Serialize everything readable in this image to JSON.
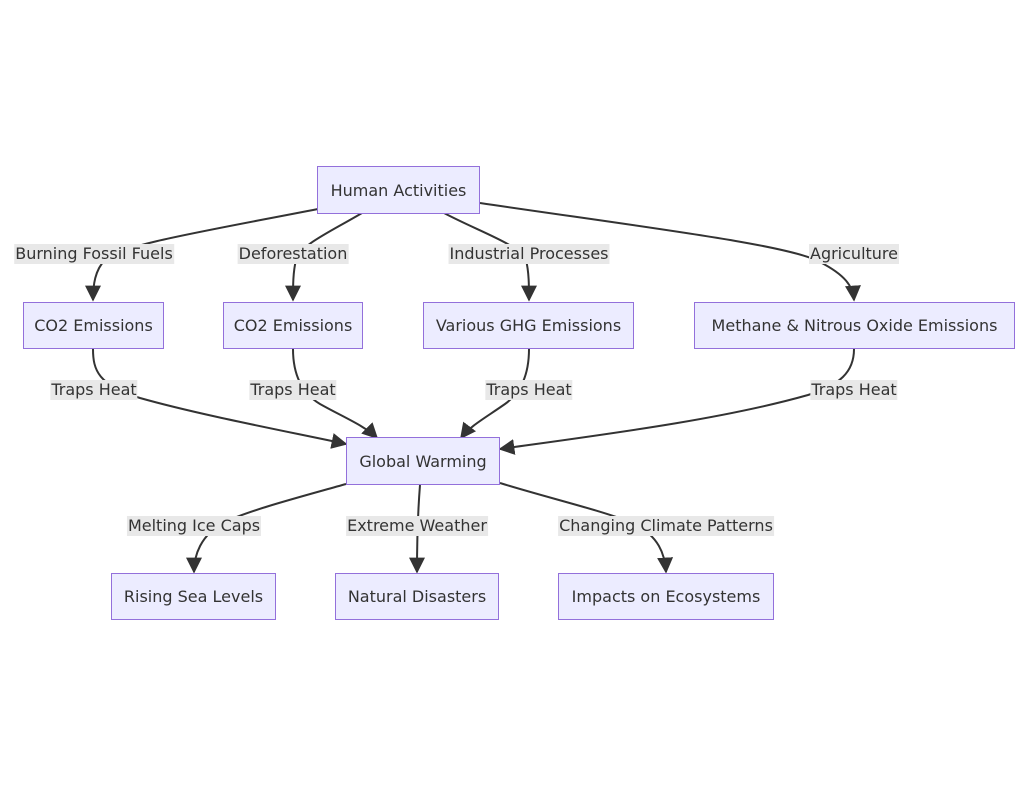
{
  "diagram": {
    "type": "flowchart",
    "colors": {
      "node_fill": "#ececff",
      "node_border": "#9370db",
      "edge": "#333333",
      "label_bg": "#e8e8e8",
      "text": "#333333"
    },
    "nodes": {
      "human": "Human Activities",
      "co2a": "CO2 Emissions",
      "co2b": "CO2 Emissions",
      "ghg": "Various GHG Emissions",
      "methane": "Methane & Nitrous Oxide Emissions",
      "warming": "Global Warming",
      "sea": "Rising Sea Levels",
      "disasters": "Natural Disasters",
      "eco": "Impacts on Ecosystems"
    },
    "edges": [
      {
        "from": "human",
        "to": "co2a",
        "label": "Burning Fossil Fuels"
      },
      {
        "from": "human",
        "to": "co2b",
        "label": "Deforestation"
      },
      {
        "from": "human",
        "to": "ghg",
        "label": "Industrial Processes"
      },
      {
        "from": "human",
        "to": "methane",
        "label": "Agriculture"
      },
      {
        "from": "co2a",
        "to": "warming",
        "label": "Traps Heat"
      },
      {
        "from": "co2b",
        "to": "warming",
        "label": "Traps Heat"
      },
      {
        "from": "ghg",
        "to": "warming",
        "label": "Traps Heat"
      },
      {
        "from": "methane",
        "to": "warming",
        "label": "Traps Heat"
      },
      {
        "from": "warming",
        "to": "sea",
        "label": "Melting Ice Caps"
      },
      {
        "from": "warming",
        "to": "disasters",
        "label": "Extreme Weather"
      },
      {
        "from": "warming",
        "to": "eco",
        "label": "Changing Climate Patterns"
      }
    ]
  }
}
